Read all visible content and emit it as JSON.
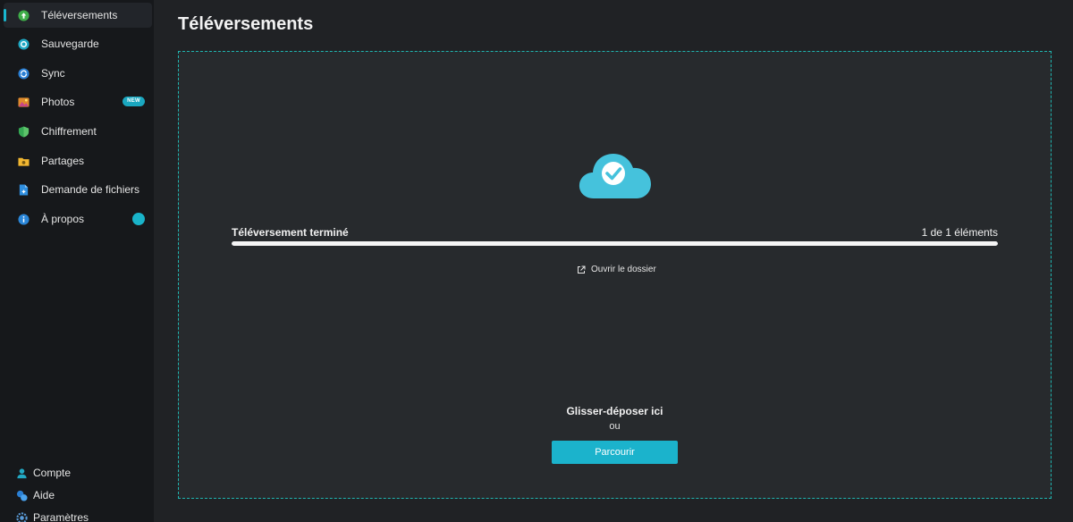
{
  "sidebar": {
    "items": [
      {
        "label": "Téléversements",
        "icon": "upload-icon",
        "active": true
      },
      {
        "label": "Sauvegarde",
        "icon": "backup-icon"
      },
      {
        "label": "Sync",
        "icon": "sync-icon"
      },
      {
        "label": "Photos",
        "icon": "photos-icon",
        "badge": "NEW"
      },
      {
        "label": "Chiffrement",
        "icon": "shield-icon"
      },
      {
        "label": "Partages",
        "icon": "share-folder-icon"
      },
      {
        "label": "Demande de fichiers",
        "icon": "file-request-icon"
      },
      {
        "label": "À propos",
        "icon": "info-icon"
      }
    ],
    "bottom": [
      {
        "label": "Compte",
        "icon": "account-icon"
      },
      {
        "label": "Aide",
        "icon": "help-icon"
      },
      {
        "label": "Paramètres",
        "icon": "settings-icon"
      }
    ]
  },
  "main": {
    "title": "Téléversements",
    "upload": {
      "status": "Téléversement terminé",
      "count": "1 de 1 éléments",
      "progress_fraction": 1.0,
      "open_folder": "Ouvrir le dossier"
    },
    "drop_hint": "Glisser-déposer ici",
    "or": "ou",
    "browse": "Parcourir"
  },
  "colors": {
    "accent": "#1bb3cc",
    "dashed_border": "#1fb5b0",
    "background": "#202225",
    "sidebar": "#16181b",
    "cloud": "#45c2dc"
  }
}
